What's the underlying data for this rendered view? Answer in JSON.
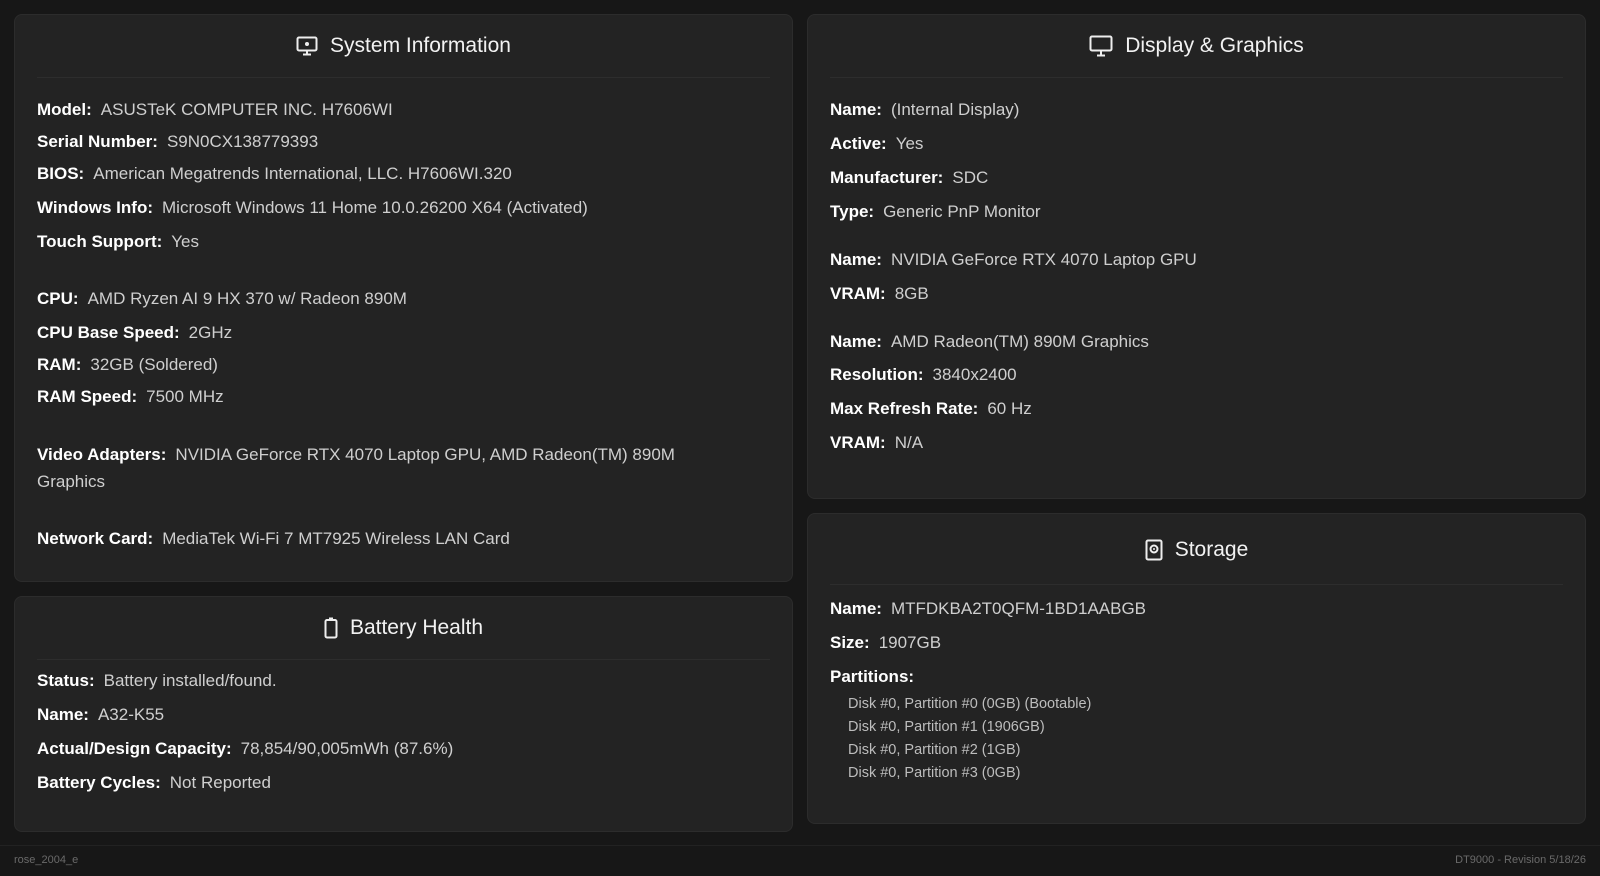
{
  "system": {
    "title": "System Information",
    "icon": "monitor-dot-icon",
    "rows": [
      {
        "label": "Model:",
        "value": "ASUSTeK COMPUTER INC. H7606WI"
      },
      {
        "label": "Serial Number:",
        "value": "S9N0CX138779393"
      },
      {
        "label": "BIOS:",
        "value": "American Megatrends International, LLC. H7606WI.320"
      },
      {
        "label": "Windows Info:",
        "value": "Microsoft Windows 11 Home 10.0.26200 X64 (Activated)"
      },
      {
        "label": "Touch Support:",
        "value": "Yes"
      },
      {
        "label": "CPU:",
        "value": "AMD Ryzen AI 9 HX 370 w/ Radeon 890M"
      },
      {
        "label": "CPU Base Speed:",
        "value": "2GHz"
      },
      {
        "label": "RAM:",
        "value": "32GB (Soldered)"
      },
      {
        "label": "RAM Speed:",
        "value": "7500 MHz"
      },
      {
        "label": "Video Adapters:",
        "value": "NVIDIA GeForce RTX 4070 Laptop GPU, AMD Radeon(TM) 890M Graphics"
      },
      {
        "label": "Network Card:",
        "value": "MediaTek Wi-Fi 7 MT7925 Wireless LAN Card"
      }
    ]
  },
  "battery": {
    "title": "Battery Health",
    "icon": "battery-icon",
    "rows": [
      {
        "label": "Status:",
        "value": "Battery installed/found."
      },
      {
        "label": "Name:",
        "value": "A32-K55"
      },
      {
        "label": "Actual/Design Capacity:",
        "value": "78,854/90,005mWh (87.6%)"
      },
      {
        "label": "Battery Cycles:",
        "value": "Not Reported"
      }
    ]
  },
  "display": {
    "title": "Display & Graphics",
    "icon": "monitor-icon",
    "rows": [
      {
        "label": "Name:",
        "value": "(Internal Display)"
      },
      {
        "label": "Active:",
        "value": "Yes"
      },
      {
        "label": "Manufacturer:",
        "value": "SDC"
      },
      {
        "label": "Type:",
        "value": "Generic PnP Monitor"
      },
      {
        "label": "Name:",
        "value": "NVIDIA GeForce RTX 4070 Laptop GPU"
      },
      {
        "label": "VRAM:",
        "value": "8GB"
      },
      {
        "label": "Name:",
        "value": "AMD Radeon(TM) 890M Graphics"
      },
      {
        "label": "Resolution:",
        "value": "3840x2400"
      },
      {
        "label": "Max Refresh Rate:",
        "value": "60 Hz"
      },
      {
        "label": "VRAM:",
        "value": "N/A"
      }
    ]
  },
  "storage": {
    "title": "Storage",
    "icon": "hard-drive-icon",
    "rows": [
      {
        "label": "Name:",
        "value": "MTFDKBA2T0QFM-1BD1AABGB"
      },
      {
        "label": "Size:",
        "value": "1907GB"
      },
      {
        "label": "Partitions:",
        "value": ""
      }
    ],
    "partitions": [
      "Disk #0, Partition #0 (0GB) (Bootable)",
      "Disk #0, Partition #1 (1906GB)",
      "Disk #0, Partition #2 (1GB)",
      "Disk #0, Partition #3 (0GB)"
    ]
  },
  "footer": {
    "left": "rose_2004_e",
    "right": "DT9000 - Revision 5/18/26"
  }
}
